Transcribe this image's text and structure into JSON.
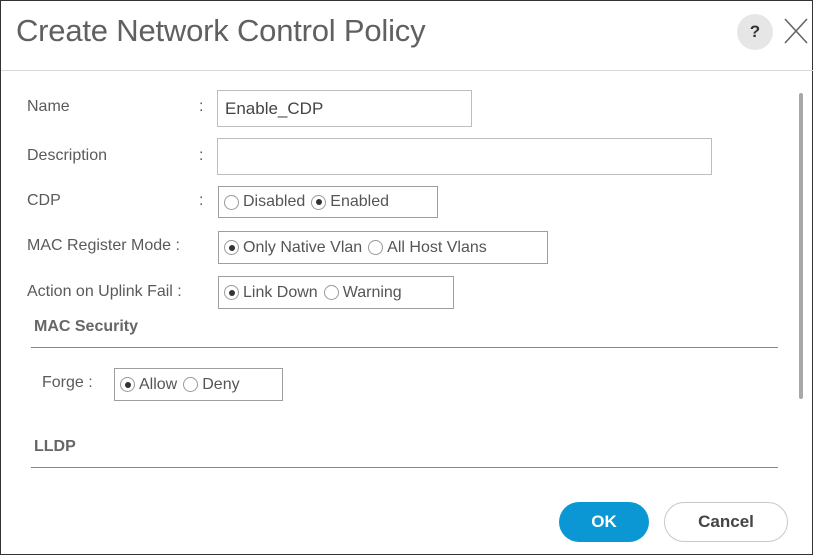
{
  "dialog": {
    "title": "Create Network Control Policy",
    "help_label": "?",
    "close_icon": "close-icon"
  },
  "form": {
    "colon": ":",
    "name": {
      "label": "Name",
      "value": "Enable_CDP"
    },
    "description": {
      "label": "Description",
      "value": ""
    },
    "cdp": {
      "label": "CDP",
      "options": [
        "Disabled",
        "Enabled"
      ],
      "selected": "Enabled"
    },
    "mac_register_mode": {
      "label": "MAC Register Mode :",
      "options": [
        "Only Native Vlan",
        "All Host Vlans"
      ],
      "selected": "Only Native Vlan"
    },
    "action_on_uplink_fail": {
      "label": "Action on Uplink Fail :",
      "options": [
        "Link Down",
        "Warning"
      ],
      "selected": "Link Down"
    }
  },
  "mac_security": {
    "heading": "MAC Security",
    "forge": {
      "label": "Forge :",
      "options": [
        "Allow",
        "Deny"
      ],
      "selected": "Allow"
    }
  },
  "lldp": {
    "heading": "LLDP"
  },
  "buttons": {
    "ok": "OK",
    "cancel": "Cancel"
  },
  "colors": {
    "primary": "#0b97d3"
  }
}
